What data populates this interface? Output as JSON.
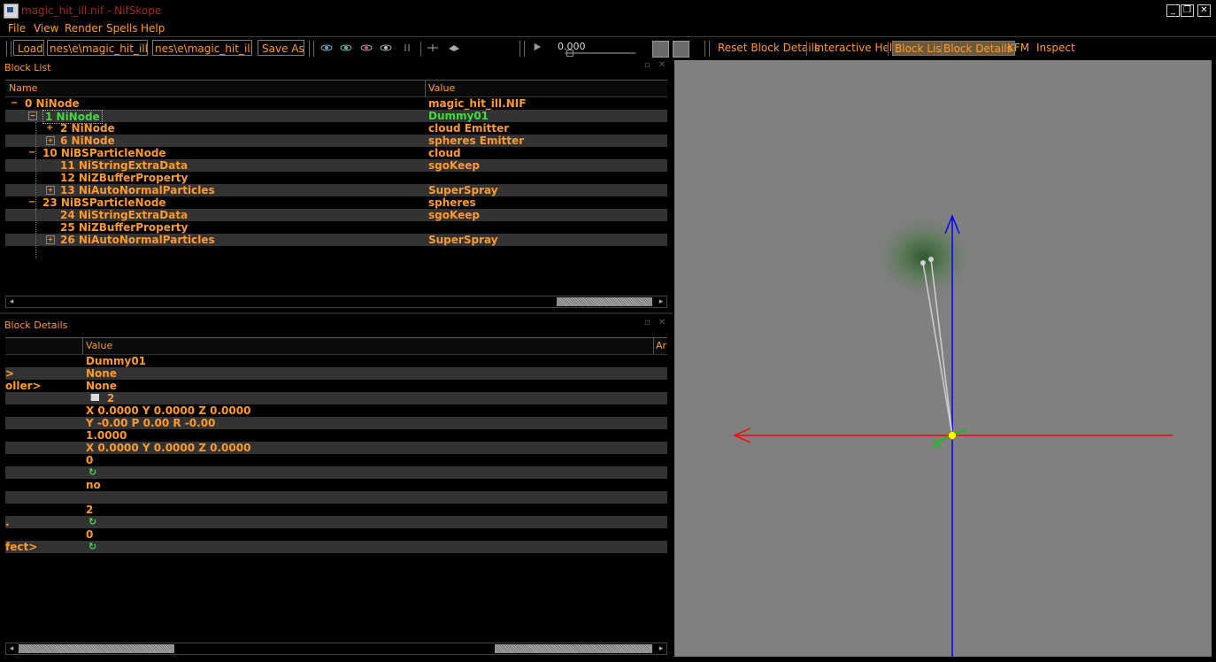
{
  "window": {
    "title": "magic_hit_ill.nif - NifSkope",
    "buttons": [
      "_",
      "❐",
      "✕"
    ]
  },
  "menu": [
    "File",
    "View",
    "Render",
    "Spells",
    "Help"
  ],
  "toolbar": {
    "load_label": "Load",
    "load_path": "nes\\e\\magic_hit_ill.nif",
    "save_path": "nes\\e\\magic_hit_ill.nif",
    "save_as_label": "Save As",
    "time_value": "0.000",
    "reset_label": "Reset Block Details",
    "help_label": "Interactive Help",
    "block_list_label": "Block List",
    "block_details_label": "Block Details",
    "kfm_label": "KFM",
    "inspect_label": "Inspect"
  },
  "block_list": {
    "title": "Block List",
    "col_name": "Name",
    "col_value": "Value",
    "rows": [
      {
        "exp": "−",
        "name": "0 NiNode",
        "value": "magic_hit_ill.NIF"
      },
      {
        "exp": "−",
        "name": "1 NiNode",
        "value": "Dummy01"
      },
      {
        "exp": "+",
        "name": "2 NiNode",
        "value": "cloud Emitter"
      },
      {
        "exp": "+",
        "name": "6 NiNode",
        "value": "spheres Emitter"
      },
      {
        "exp": "−",
        "name": "10 NiBSParticleNode",
        "value": "cloud"
      },
      {
        "exp": "",
        "name": "11 NiStringExtraData",
        "value": "sgoKeep"
      },
      {
        "exp": "",
        "name": "12 NiZBufferProperty",
        "value": ""
      },
      {
        "exp": "+",
        "name": "13 NiAutoNormalParticles",
        "value": "SuperSpray"
      },
      {
        "exp": "−",
        "name": "23 NiBSParticleNode",
        "value": "spheres"
      },
      {
        "exp": "",
        "name": "24 NiStringExtraData",
        "value": "sgoKeep"
      },
      {
        "exp": "",
        "name": "25 NiZBufferProperty",
        "value": ""
      },
      {
        "exp": "+",
        "name": "26 NiAutoNormalParticles",
        "value": "SuperSpray"
      }
    ]
  },
  "block_details": {
    "title": "Block Details",
    "col_value": "Value",
    "col_arg": "Ar",
    "rows": [
      {
        "name": "",
        "value": "Dummy01",
        "icon": ""
      },
      {
        "name": ">",
        "value": "None",
        "icon": ""
      },
      {
        "name": "oller>",
        "value": "None",
        "icon": ""
      },
      {
        "name": "",
        "value": "2",
        "icon": "flag"
      },
      {
        "name": "",
        "value": "X 0.0000 Y 0.0000 Z 0.0000",
        "icon": ""
      },
      {
        "name": "",
        "value": "Y -0.00 P 0.00 R -0.00",
        "icon": ""
      },
      {
        "name": "",
        "value": "1.0000",
        "icon": ""
      },
      {
        "name": "",
        "value": "X 0.0000 Y 0.0000 Z 0.0000",
        "icon": ""
      },
      {
        "name": "",
        "value": "0",
        "icon": ""
      },
      {
        "name": "",
        "value": "",
        "icon": "refresh"
      },
      {
        "name": "",
        "value": "no",
        "icon": ""
      },
      {
        "name": "",
        "value": "",
        "icon": ""
      },
      {
        "name": "",
        "value": "2",
        "icon": ""
      },
      {
        "name": ".",
        "value": "",
        "icon": "refresh"
      },
      {
        "name": "",
        "value": "0",
        "icon": ""
      },
      {
        "name": "fect>",
        "value": "",
        "icon": "refresh"
      }
    ]
  },
  "colors": {
    "accent": "#ff9a2e",
    "selected": "#3fdc3f",
    "viewport_bg": "#808080",
    "axis_x": "#ff0000",
    "axis_y": "#0000ff",
    "axis_z": "#00ff00"
  }
}
